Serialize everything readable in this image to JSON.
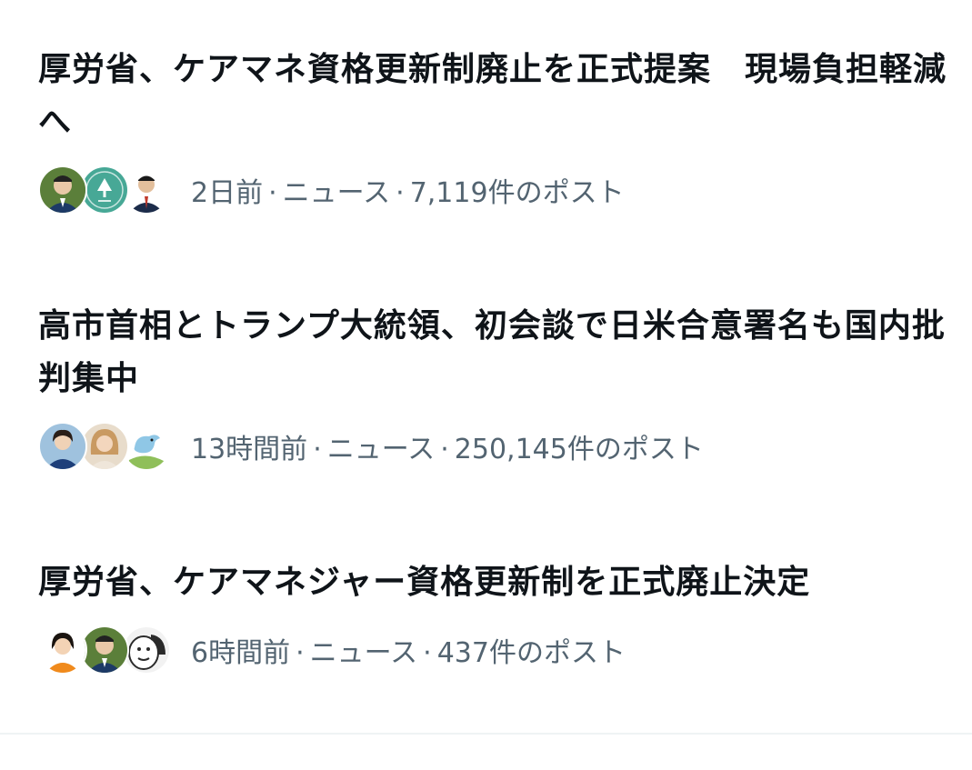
{
  "items": [
    {
      "headline": "厚労省、ケアマネ資格更新制廃止を正式提案　現場負担軽減へ",
      "time": "2日前",
      "category": "ニュース",
      "posts": "7,119件のポスト",
      "avatars": [
        {
          "icon": "person-avatar-icon",
          "bg": "#5b7f3a",
          "skin": "#e9c8a8",
          "suit": "#1d3a66"
        },
        {
          "icon": "tree-logo-avatar-icon",
          "bg": "#47a896",
          "skin": "#ffffff",
          "suit": "#2e8a78"
        },
        {
          "icon": "person-avatar-icon",
          "bg": "#ffffff",
          "skin": "#e3bf9c",
          "suit": "#1c2c4a"
        }
      ]
    },
    {
      "headline": "高市首相とトランプ大統領、初会談で日米合意署名も国内批判集中",
      "time": "13時間前",
      "category": "ニュース",
      "posts": "250,145件のポスト",
      "avatars": [
        {
          "icon": "person-avatar-icon",
          "bg": "#9fc2de",
          "skin": "#f0d2b6",
          "suit": "#1e3f7a"
        },
        {
          "icon": "person-avatar-icon",
          "bg": "#e8dccb",
          "skin": "#f3d6bd",
          "suit": "#c99a62"
        },
        {
          "icon": "bird-avatar-icon",
          "bg": "#ffffff",
          "skin": "#8fc7e6",
          "suit": "#8fbf5a"
        }
      ]
    },
    {
      "headline": "厚労省、ケアマネジャー資格更新制を正式廃止決定",
      "time": "6時間前",
      "category": "ニュース",
      "posts": "437件のポスト",
      "avatars": [
        {
          "icon": "person-avatar-icon",
          "bg": "#ffffff",
          "skin": "#f3d3b5",
          "suit": "#f08a1c"
        },
        {
          "icon": "person-avatar-icon",
          "bg": "#5b7f3a",
          "skin": "#e9c8a8",
          "suit": "#1d3a66"
        },
        {
          "icon": "cartoon-avatar-icon",
          "bg": "#f2f2f2",
          "skin": "#ffffff",
          "suit": "#2a2a2a"
        }
      ]
    }
  ],
  "separator": "·"
}
